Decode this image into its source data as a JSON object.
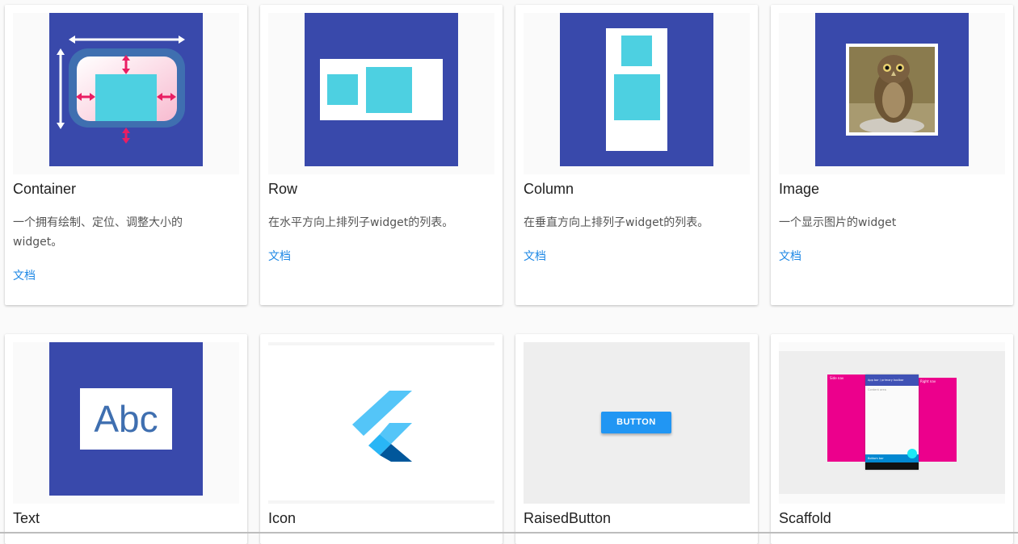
{
  "cards": [
    {
      "title": "Container",
      "desc": "一个拥有绘制、定位、调整大小的 widget。",
      "doc": "文档"
    },
    {
      "title": "Row",
      "desc": "在水平方向上排列子widget的列表。",
      "doc": "文档"
    },
    {
      "title": "Column",
      "desc": "在垂直方向上排列子widget的列表。",
      "doc": "文档"
    },
    {
      "title": "Image",
      "desc": "一个显示图片的widget",
      "doc": "文档"
    },
    {
      "title": "Text",
      "thumb_text": "Abc"
    },
    {
      "title": "Icon"
    },
    {
      "title": "RaisedButton",
      "button_label": "BUTTON"
    },
    {
      "title": "Scaffold",
      "mock": {
        "left_drawer": "Side nav",
        "right_drawer": "Right nav",
        "appbar": "App bar / primary toolbar",
        "content": "Content area",
        "bottom": "Bottom bar"
      }
    }
  ],
  "colors": {
    "indigo": "#3949ab",
    "cyan": "#4dd0e1",
    "link": "#1e88e5",
    "magenta": "#ec008c",
    "button": "#2196f3"
  }
}
